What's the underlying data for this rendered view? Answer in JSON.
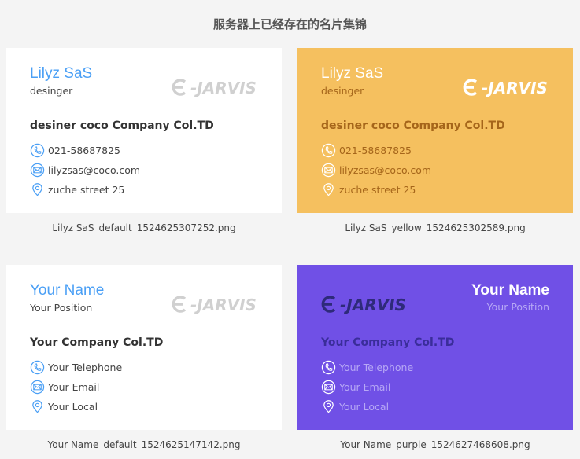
{
  "page": {
    "title": "服务器上已经存在的名片集锦"
  },
  "logo": {
    "text": "E-JARVIS"
  },
  "colors": {
    "white_name": "#4a9ff5",
    "yellow_bg": "#f5c05f",
    "yellow_text": "#a5651a",
    "purple_bg": "#7050e6",
    "purple_text": "#b7a8f5",
    "dark_text": "#333333"
  },
  "cards": [
    {
      "variant": "default",
      "name": "Lilyz SaS",
      "position": "desinger",
      "company": "desiner coco Company Col.TD",
      "phone": "021-58687825",
      "email": "lilyzsas@coco.com",
      "location": "zuche street 25",
      "filename": "Lilyz SaS_default_1524625307252.png"
    },
    {
      "variant": "yellow",
      "name": "Lilyz SaS",
      "position": "desinger",
      "company": "desiner coco Company Col.TD",
      "phone": "021-58687825",
      "email": "lilyzsas@coco.com",
      "location": "zuche street 25",
      "filename": "Lilyz SaS_yellow_1524625302589.png"
    },
    {
      "variant": "default",
      "name": "Your Name",
      "position": "Your Position",
      "company": "Your Company Col.TD",
      "phone": "Your Telephone",
      "email": "Your Email",
      "location": "Your Local",
      "filename": "Your Name_default_1524625147142.png"
    },
    {
      "variant": "purple",
      "name": "Your Name",
      "position": "Your Position",
      "company": "Your Company Col.TD",
      "phone": "Your Telephone",
      "email": "Your Email",
      "location": "Your Local",
      "filename": "Your Name_purple_1524627468608.png"
    }
  ],
  "icons": {
    "phone": "phone-icon",
    "email": "email-icon",
    "location": "location-pin-icon"
  }
}
